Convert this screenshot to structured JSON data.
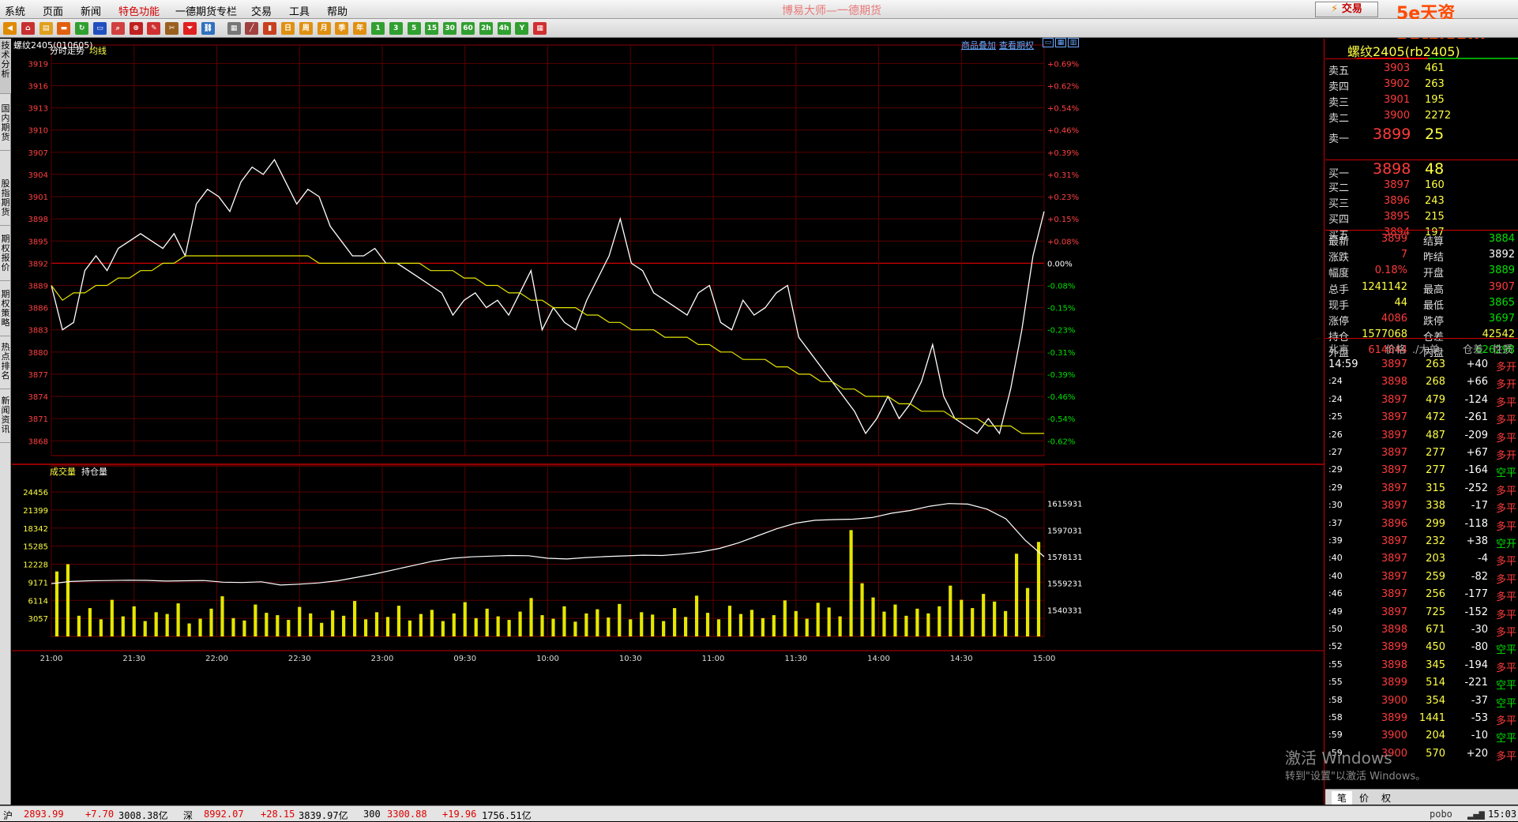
{
  "menu": {
    "items": [
      "系统",
      "页面",
      "新闻",
      "特色功能",
      "一德期货专栏",
      "交易",
      "工具",
      "帮助"
    ],
    "app_title": "博易大师—一德期货",
    "trade_button": "交易",
    "site_watermark": "5e天资5etz.com"
  },
  "toolbar": {
    "buttons": [
      "back",
      "home",
      "notes",
      "flash",
      "refresh",
      "list",
      "search",
      "zoom",
      "draw",
      "tool",
      "filter",
      "link",
      "table",
      "chart",
      "kline",
      "day",
      "week",
      "month",
      "season",
      "year",
      "1",
      "3",
      "5",
      "15",
      "30",
      "60",
      "2h",
      "4h",
      "Y",
      "calc"
    ]
  },
  "left_tabs": [
    "技术分析",
    "国内期货",
    "股指期货",
    "期权报价",
    "期权策略",
    "热点排名",
    "新闻资讯"
  ],
  "chart": {
    "symbol_label": "螺纹2405(010605)",
    "link_overlay": "商品叠加",
    "link_options": "查看期权",
    "price_panel_title": "分时走势",
    "avg_label": "均线",
    "vol_panel_title": "成交量",
    "oi_label": "持仓量",
    "price_ticks": [
      "3919",
      "3916",
      "3913",
      "3910",
      "3907",
      "3904",
      "3901",
      "3898",
      "3895",
      "3892",
      "3889",
      "3886",
      "3883",
      "3880",
      "3877",
      "3874",
      "3871",
      "3868"
    ],
    "pct_ticks": [
      "+0.69%",
      "+0.62%",
      "+0.54%",
      "+0.46%",
      "+0.39%",
      "+0.31%",
      "+0.23%",
      "+0.15%",
      "+0.08%",
      "0.00%",
      "-0.08%",
      "-0.15%",
      "-0.23%",
      "-0.31%",
      "-0.39%",
      "-0.46%",
      "-0.54%",
      "-0.62%"
    ],
    "vol_ticks": [
      "24456",
      "21399",
      "18342",
      "15285",
      "12228",
      "9171",
      "6114",
      "3057"
    ],
    "oi_ticks": [
      "1615931",
      "1597031",
      "1578131",
      "1559231",
      "1540331"
    ],
    "time_ticks": [
      "21:00",
      "21:30",
      "22:00",
      "22:30",
      "23:00",
      "09:30",
      "10:00",
      "10:30",
      "11:00",
      "11:30",
      "14:00",
      "14:30",
      "15:00"
    ],
    "colors": {
      "price": "#ffffff",
      "avg": "#e6e600",
      "grid": "#8b0000",
      "volume": "#e6e600"
    }
  },
  "chart_data": {
    "type": "line",
    "title": "分时走势",
    "series": [
      {
        "name": "分时走势",
        "values": [
          3889,
          3883,
          3884,
          3891,
          3893,
          3891,
          3894,
          3895,
          3896,
          3895,
          3894,
          3896,
          3893,
          3900,
          3902,
          3901,
          3899,
          3903,
          3905,
          3904,
          3906,
          3903,
          3900,
          3902,
          3901,
          3897,
          3895,
          3893,
          3893,
          3894,
          3892,
          3892,
          3891,
          3890,
          3889,
          3888,
          3885,
          3887,
          3888,
          3886,
          3887,
          3885,
          3888,
          3891,
          3883,
          3886,
          3884,
          3883,
          3887,
          3890,
          3893,
          3898,
          3892,
          3891,
          3888,
          3887,
          3886,
          3885,
          3888,
          3889,
          3884,
          3883,
          3887,
          3885,
          3886,
          3888,
          3889,
          3882,
          3880,
          3878,
          3876,
          3874,
          3872,
          3869,
          3871,
          3874,
          3871,
          3873,
          3876,
          3881,
          3874,
          3871,
          3870,
          3869,
          3871,
          3869,
          3875,
          3883,
          3893,
          3899
        ]
      },
      {
        "name": "均线",
        "values": [
          3889,
          3887,
          3888,
          3888,
          3889,
          3889,
          3890,
          3890,
          3891,
          3891,
          3892,
          3892,
          3893,
          3893,
          3893,
          3893,
          3893,
          3893,
          3893,
          3893,
          3893,
          3893,
          3893,
          3893,
          3892,
          3892,
          3892,
          3892,
          3892,
          3892,
          3892,
          3892,
          3892,
          3892,
          3891,
          3891,
          3891,
          3890,
          3890,
          3889,
          3889,
          3888,
          3888,
          3887,
          3887,
          3886,
          3886,
          3886,
          3885,
          3885,
          3884,
          3884,
          3883,
          3883,
          3883,
          3882,
          3882,
          3882,
          3881,
          3881,
          3880,
          3880,
          3879,
          3879,
          3879,
          3878,
          3878,
          3877,
          3877,
          3876,
          3876,
          3875,
          3875,
          3874,
          3874,
          3874,
          3873,
          3873,
          3872,
          3872,
          3872,
          3871,
          3871,
          3871,
          3870,
          3870,
          3870,
          3869,
          3869,
          3869
        ]
      }
    ],
    "volume": [
      11000,
      12228,
      3500,
      4800,
      2900,
      6200,
      3400,
      5100,
      2600,
      4100,
      3800,
      5600,
      2200,
      3000,
      4700,
      6800,
      3100,
      2700,
      5400,
      4000,
      3600,
      2800,
      5000,
      3900,
      2300,
      4400,
      3500,
      6000,
      2900,
      4100,
      3300,
      5200,
      2700,
      3800,
      4500,
      2600,
      3900,
      5800,
      3100,
      4700,
      3400,
      2800,
      4200,
      6500,
      3600,
      3000,
      5100,
      2500,
      3900,
      4600,
      3200,
      5500,
      2900,
      4100,
      3700,
      2600,
      4800,
      3300,
      6900,
      4000,
      2900,
      5200,
      3800,
      4500,
      3100,
      3600,
      6100,
      4300,
      3000,
      5700,
      4900,
      3400,
      18000,
      9000,
      6600,
      4200,
      5400,
      3500,
      4700,
      3900,
      5100,
      8600,
      6200,
      4800,
      7200,
      5900,
      4300,
      14000,
      8200,
      16000
    ],
    "open_interest": [
      1559000,
      1560500,
      1561000,
      1561200,
      1561400,
      1561300,
      1560800,
      1561000,
      1561200,
      1560000,
      1559800,
      1560300,
      1558000,
      1558600,
      1559500,
      1561000,
      1563500,
      1566000,
      1569000,
      1572000,
      1575000,
      1577000,
      1578000,
      1578500,
      1579000,
      1578800,
      1577000,
      1576500,
      1577500,
      1578200,
      1578700,
      1579200,
      1579000,
      1580000,
      1581500,
      1584000,
      1588000,
      1593000,
      1598000,
      1602000,
      1604000,
      1604500,
      1604800,
      1606000,
      1609000,
      1611000,
      1614000,
      1615931,
      1615500,
      1612000,
      1605000,
      1590000,
      1578131
    ],
    "ylim": [
      3866,
      3920
    ],
    "x_ticks": [
      "21:00",
      "21:30",
      "22:00",
      "22:30",
      "23:00",
      "09:30",
      "10:00",
      "10:30",
      "11:00",
      "11:30",
      "14:00",
      "14:30",
      "15:00"
    ],
    "prev_settle": 3892
  },
  "quote": {
    "title": "螺纹2405(rb2405)",
    "asks": [
      {
        "label": "卖五",
        "price": "3903",
        "vol": "461"
      },
      {
        "label": "卖四",
        "price": "3902",
        "vol": "263"
      },
      {
        "label": "卖三",
        "price": "3901",
        "vol": "195"
      },
      {
        "label": "卖二",
        "price": "3900",
        "vol": "2272"
      },
      {
        "label": "卖一",
        "price": "3899",
        "vol": "25"
      }
    ],
    "bids": [
      {
        "label": "买一",
        "price": "3898",
        "vol": "48"
      },
      {
        "label": "买二",
        "price": "3897",
        "vol": "160"
      },
      {
        "label": "买三",
        "price": "3896",
        "vol": "243"
      },
      {
        "label": "买四",
        "price": "3895",
        "vol": "215"
      },
      {
        "label": "买五",
        "price": "3894",
        "vol": "197"
      }
    ],
    "stats": [
      {
        "l1": "最新",
        "v1": "3899",
        "c1": "red",
        "l2": "结算",
        "v2": "3884",
        "c2": "grn"
      },
      {
        "l1": "涨跌",
        "v1": "7",
        "c1": "red",
        "l2": "昨结",
        "v2": "3892",
        "c2": "wht"
      },
      {
        "l1": "幅度",
        "v1": "0.18%",
        "c1": "red",
        "l2": "开盘",
        "v2": "3889",
        "c2": "grn"
      },
      {
        "l1": "总手",
        "v1": "1241142",
        "c1": "yel",
        "l2": "最高",
        "v2": "3907",
        "c2": "red"
      },
      {
        "l1": "现手",
        "v1": "44",
        "c1": "yel",
        "l2": "最低",
        "v2": "3865",
        "c2": "grn"
      },
      {
        "l1": "涨停",
        "v1": "4086",
        "c1": "red",
        "l2": "跌停",
        "v2": "3697",
        "c2": "grn"
      },
      {
        "l1": "持仓",
        "v1": "1577068",
        "c1": "yel",
        "l2": "仓差",
        "v2": "42542",
        "c2": "yel"
      },
      {
        "l1": "外盘",
        "v1": "614844",
        "c1": "red",
        "l2": "内盘",
        "v2": "626298",
        "c2": "grn"
      }
    ],
    "tick_header": [
      "北京",
      "价格",
      "./大单",
      "仓差",
      "性质"
    ],
    "ticks": [
      {
        "t": "14:59",
        "p": "3897",
        "v": "263",
        "d": "+40",
        "n": "多开"
      },
      {
        "t": ":24",
        "p": "3898",
        "v": "268",
        "d": "+66",
        "n": "多开"
      },
      {
        "t": ":24",
        "p": "3897",
        "v": "479",
        "d": "-124",
        "n": "多平"
      },
      {
        "t": ":25",
        "p": "3897",
        "v": "472",
        "d": "-261",
        "n": "多平"
      },
      {
        "t": ":26",
        "p": "3897",
        "v": "487",
        "d": "-209",
        "n": "多平"
      },
      {
        "t": ":27",
        "p": "3897",
        "v": "277",
        "d": "+67",
        "n": "多开"
      },
      {
        "t": ":29",
        "p": "3897",
        "v": "277",
        "d": "-164",
        "n": "空平"
      },
      {
        "t": ":29",
        "p": "3897",
        "v": "315",
        "d": "-252",
        "n": "多平"
      },
      {
        "t": ":30",
        "p": "3897",
        "v": "338",
        "d": "-17",
        "n": "多平"
      },
      {
        "t": ":37",
        "p": "3896",
        "v": "299",
        "d": "-118",
        "n": "多平"
      },
      {
        "t": ":39",
        "p": "3897",
        "v": "232",
        "d": "+38",
        "n": "空开"
      },
      {
        "t": ":40",
        "p": "3897",
        "v": "203",
        "d": "-4",
        "n": "多平"
      },
      {
        "t": ":40",
        "p": "3897",
        "v": "259",
        "d": "-82",
        "n": "多平"
      },
      {
        "t": ":46",
        "p": "3897",
        "v": "256",
        "d": "-177",
        "n": "多平"
      },
      {
        "t": ":49",
        "p": "3897",
        "v": "725",
        "d": "-152",
        "n": "多平"
      },
      {
        "t": ":50",
        "p": "3898",
        "v": "671",
        "d": "-30",
        "n": "多平"
      },
      {
        "t": ":52",
        "p": "3899",
        "v": "450",
        "d": "-80",
        "n": "空平"
      },
      {
        "t": ":55",
        "p": "3898",
        "v": "345",
        "d": "-194",
        "n": "多平"
      },
      {
        "t": ":55",
        "p": "3899",
        "v": "514",
        "d": "-221",
        "n": "空平"
      },
      {
        "t": ":58",
        "p": "3900",
        "v": "354",
        "d": "-37",
        "n": "空平"
      },
      {
        "t": ":58",
        "p": "3899",
        "v": "1441",
        "d": "-53",
        "n": "多平"
      },
      {
        "t": ":59",
        "p": "3900",
        "v": "204",
        "d": "-10",
        "n": "空平"
      },
      {
        "t": ":59",
        "p": "3900",
        "v": "570",
        "d": "+20",
        "n": "多平"
      }
    ],
    "bottom_tabs": [
      "笔",
      "价",
      "权"
    ]
  },
  "os": {
    "activate_title": "激活 Windows",
    "activate_text": "转到\"设置\"以激活 Windows。"
  },
  "statusbar": {
    "items": [
      {
        "name": "沪",
        "v": "2893.99",
        "c": "+7.70",
        "a": "3008.38亿"
      },
      {
        "name": "深",
        "v": "8992.07",
        "c": "+28.15",
        "a": "3839.97亿"
      },
      {
        "name": "300",
        "v": "3300.88",
        "c": "+19.96",
        "a": "1756.51亿"
      }
    ],
    "brand": "pobo",
    "time": "15:03"
  }
}
